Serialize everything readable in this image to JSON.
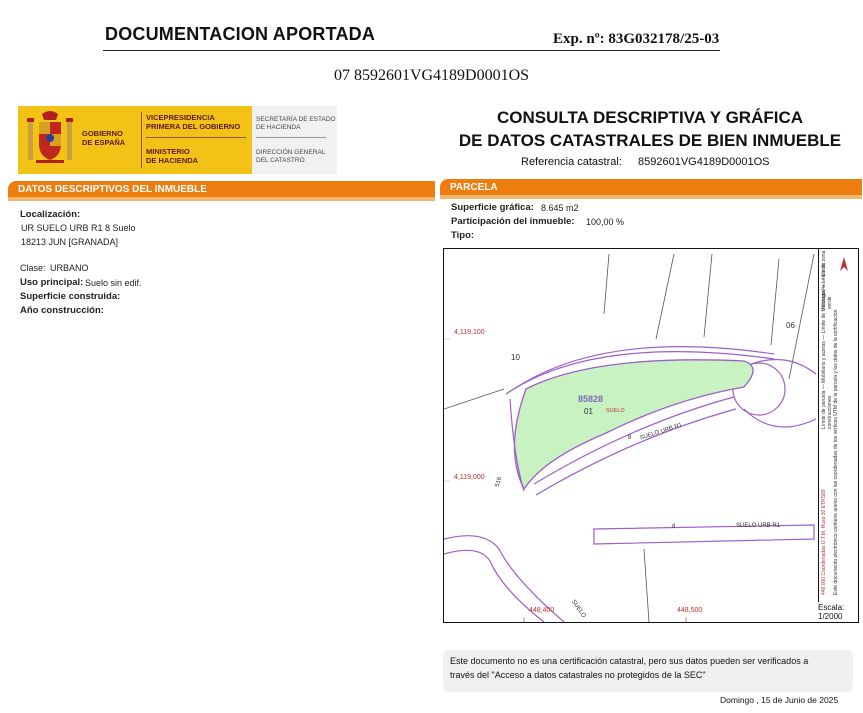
{
  "header": {
    "title": "DOCUMENTACION APORTADA",
    "expediente": "Exp. nº: 83G032178/25-03",
    "reference_line": "07 8592601VG4189D0001OS"
  },
  "logo": {
    "gobierno": [
      "GOBIERNO",
      "DE ESPAÑA"
    ],
    "vicepresidencia": [
      "VICEPRESIDENCIA",
      "PRIMERA DEL GOBIERNO"
    ],
    "ministerio": [
      "MINISTERIO",
      "DE HACIENDA"
    ],
    "secretaria": [
      "SECRETARÍA DE ESTADO",
      "DE HACIENDA"
    ],
    "direccion": [
      "DIRECCIÓN GENERAL",
      "DEL CATASTRO"
    ],
    "brand_color": "#f2c316"
  },
  "document": {
    "title_line1": "CONSULTA DESCRIPTIVA Y GRÁFICA",
    "title_line2": "DE DATOS CATASTRALES DE BIEN INMUEBLE",
    "ref_label": "Referencia catastral:",
    "ref_value": "8592601VG4189D0001OS"
  },
  "descriptivos": {
    "section_title": "DATOS DESCRIPTIVOS DEL INMUEBLE",
    "localizacion_label": "Localización:",
    "localizacion_line1": "UR SUELO URB R1 8 Suelo",
    "localizacion_line2": "18213 JUN [GRANADA]",
    "clase_label": "Clase:",
    "clase_value": "URBANO",
    "uso_label": "Uso principal:",
    "uso_value": "Suelo sin edif.",
    "superficie_label": "Superficie construida:",
    "anio_label": "Año construcción:"
  },
  "parcela": {
    "section_title": "PARCELA",
    "superficie_label": "Superficie gráfica:",
    "superficie_value": "8.645 m2",
    "participacion_label": "Participación del inmueble:",
    "participacion_value": "100,00 %",
    "tipo_label": "Tipo:"
  },
  "map": {
    "y_top_label": "4,119,100",
    "y_bottom_label": "4,119,000",
    "x_left_label": "448,400",
    "x_right_label": "448,500",
    "parcel_number": "85828",
    "subparcel": "01",
    "subparcel_use": "SUELO",
    "street_upper": "SUELO URB R1",
    "street_lower": "SUELO URB R1",
    "street_bottom": "SUELO",
    "street_number_upper": "8",
    "street_number_lower": "8",
    "side_label": "516",
    "neighbor_10": "10",
    "neighbor_06": "06",
    "parcel_fill": "#c9f2c3",
    "line_color": "#9d5fc9",
    "legend_right": "Hidrografía — Límite zona verde",
    "legend_left": "Límite de parcela — Mobiliario y aceras — Límite de Manzana — Límite de construcciones",
    "legend_coords": "Este documento electrónico contiene anexo con las coordenadas de los vértices UTM de la parcela y los datos de la certificación",
    "legend_scale_note": "448.000 Coordenadas U.T.M. Huso 30 ETRS89",
    "escala_label": "Escala:",
    "escala_value": "1/2000"
  },
  "footer": {
    "note_line1": "Este documento no es una certificación catastral, pero sus datos pueden ser verificados a",
    "note_line2": "través del \"Acceso a datos catastrales no protegidos de la SEC\"",
    "date": "Domingo , 15 de Junio de 2025"
  }
}
